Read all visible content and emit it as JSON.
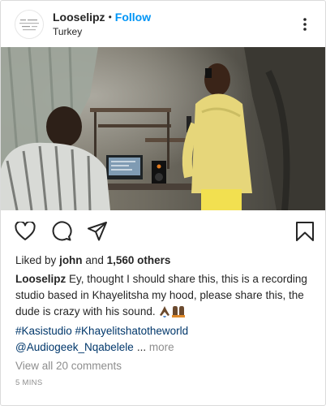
{
  "post": {
    "username": "Looselipz",
    "separator": "•",
    "follow_label": "Follow",
    "location": "Turkey",
    "likes_prefix": "Liked by",
    "liked_by_user": "john",
    "likes_and": "and",
    "likes_count": "1,560 others",
    "caption_username": "Looselipz",
    "caption_text": "Ey, thought I should share this, this is a recording studio based in Khayelitsha my hood, please share this, the dude is crazy with his sound.",
    "caption_emojis": [
      "folded-hands",
      "raised-hands"
    ],
    "hashtags": "#Kasistudio #Khayelitshatotheworld",
    "mention": "@Audiogeek_Nqabelele",
    "ellipsis": "...",
    "more_label": "more",
    "view_comments": "View all 20 comments",
    "timestamp": "5 MINS"
  },
  "icons": {
    "more": "more-options-icon",
    "like": "heart-icon",
    "comment": "comment-icon",
    "share": "share-icon",
    "save": "bookmark-icon"
  },
  "colors": {
    "link_blue": "#0095f6",
    "hashtag": "#00376b",
    "muted": "#8e8e8e",
    "text": "#262626"
  }
}
